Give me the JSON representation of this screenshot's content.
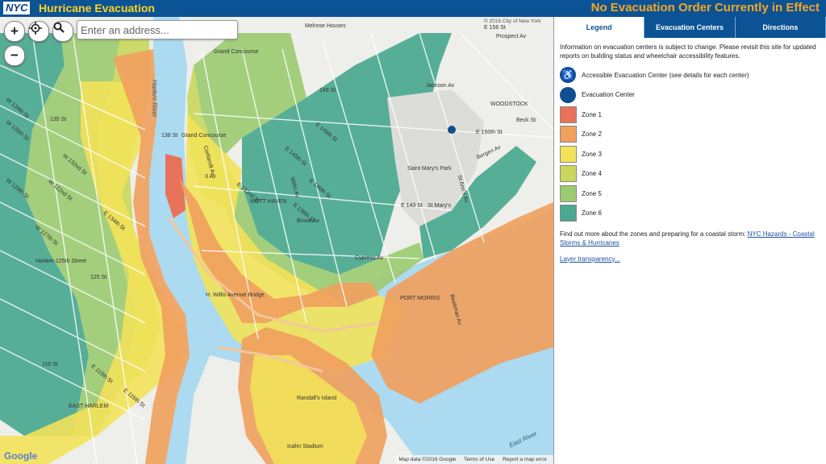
{
  "header": {
    "logo_text": "NYC",
    "app_title": "Hurricane Evacuation",
    "status_text": "No Evacuation Order Currently in Effect",
    "colors": {
      "bar": "#0b5394",
      "title": "#ffd21f",
      "status": "#f6a623"
    }
  },
  "map": {
    "controls": {
      "zoom_in": "+",
      "zoom_out": "−",
      "locate_icon": "crosshair-icon",
      "search_icon": "magnifier-icon"
    },
    "search": {
      "placeholder": "Enter an address...",
      "value": ""
    },
    "rivers": [
      "Harlem River",
      "East River"
    ],
    "labels": [
      "Melrose Houses",
      "E 156 St",
      "Prospect Av",
      "Grand Concourse",
      "149 St",
      "Jackson Av",
      "WOODSTOCK",
      "Beck St",
      "E 150th St",
      "138 St",
      "Grand Concourse",
      "Saint Mary's Park",
      "E 143 St",
      "St Mary's",
      "Brook Av",
      "Cypress Av",
      "Harlem-125th Street",
      "125 St",
      "135 St",
      "116 St",
      "H. Willis Avenue Bridge",
      "EAST HARLEM",
      "PORT MORRIS",
      "Icahn Stadium",
      "3 Av",
      "E 149th St",
      "E 145th St",
      "E 140th St",
      "E 138th St",
      "E 134th St",
      "E 132nd St",
      "MOTT HAVEN",
      "Willis Av",
      "W 134th St",
      "W 135th St",
      "W 132nd St",
      "W 129th St",
      "W 127th St",
      "W 122nd St",
      "E 119th St",
      "E 116th St",
      "Randall's Island",
      "Cortlandt Av",
      "Bergen Av",
      "St Ann's Av",
      "Beekman Av"
    ],
    "attribution": {
      "copyright": "© 2016 City of New York",
      "map_data": "Map data ©2016 Google",
      "terms": "Terms of Use",
      "report": "Report a map error",
      "google": "Google"
    },
    "zone_colors": {
      "zone1": "#e8735a",
      "zone2": "#f0a15e",
      "zone3": "#f2e25a",
      "zone4": "#c9d85d",
      "zone5": "#9ccb72",
      "zone6": "#4aa88f",
      "water": "#acdaf0",
      "land": "#eeeeea"
    }
  },
  "panel": {
    "tabs": [
      "Legend",
      "Evacuation Centers",
      "Directions"
    ],
    "active_tab": "Legend",
    "info_text": "Information on evacuation centers is subject to change. Please revisit this site for updated reports on building status and wheelchair accessibility features.",
    "legend": {
      "accessible": "Accessible Evacuation Center (see details for each center)",
      "center": "Evacuation Center",
      "zones": [
        {
          "label": "Zone 1",
          "color": "#e8735a"
        },
        {
          "label": "Zone 2",
          "color": "#f0a15e"
        },
        {
          "label": "Zone 3",
          "color": "#f2e25a"
        },
        {
          "label": "Zone 4",
          "color": "#c9d85d"
        },
        {
          "label": "Zone 5",
          "color": "#9ccb72"
        },
        {
          "label": "Zone 6",
          "color": "#4aa88f"
        }
      ]
    },
    "more_prefix": "Find out more about the zones and preparing for a coastal storm: ",
    "more_link": "NYC Hazards - Coastal Storms & Hurricanes",
    "transparency_link": "Layer transparency..."
  }
}
